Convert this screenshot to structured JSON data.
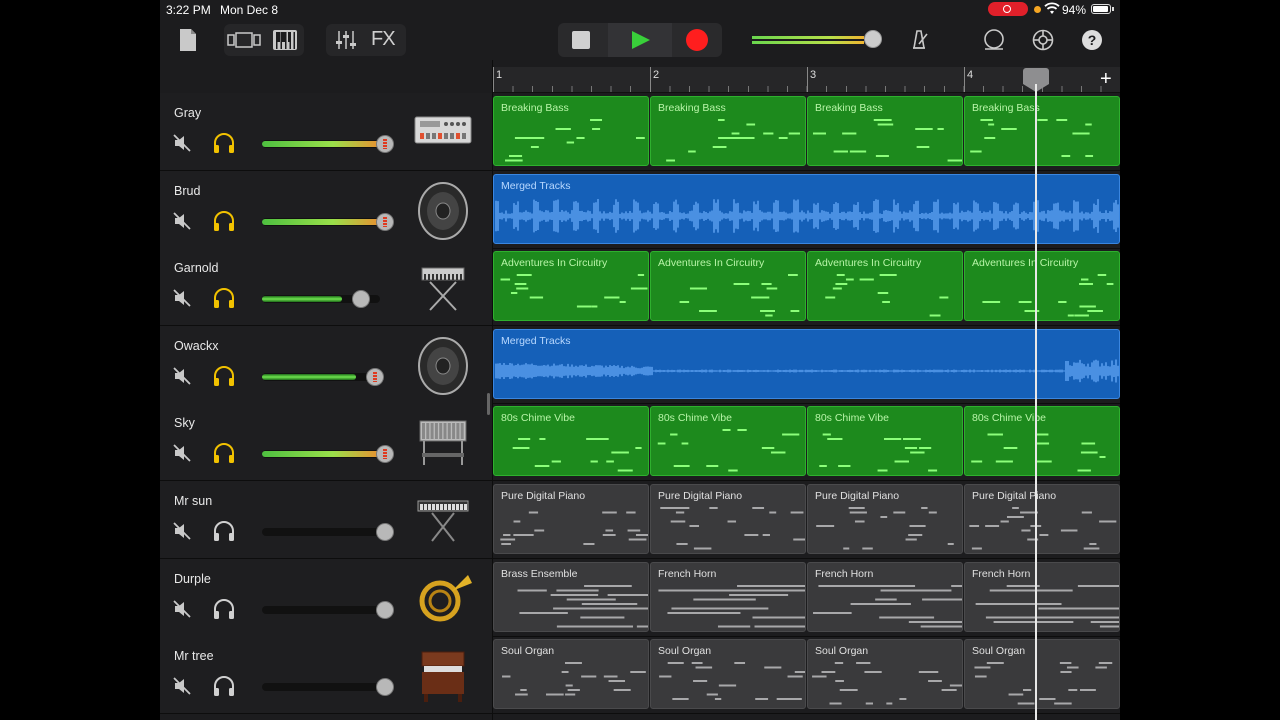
{
  "status_bar": {
    "time": "3:22 PM",
    "date": "Mon Dec 8",
    "battery": "94%",
    "battery_level": 0.94
  },
  "toolbar": {
    "fx_label": "FX",
    "help_label": "?",
    "master_volume": 0.95
  },
  "ruler": {
    "bars": [
      "1",
      "2",
      "3",
      "4"
    ],
    "add_label": "+"
  },
  "playhead_position_bars": 4.46,
  "colors": {
    "midi_region": "#1d8a1d",
    "audio_region": "#1560b8",
    "inactive_region": "#3a3a3c",
    "record": "#ff1e1e",
    "play": "#39d03a",
    "solo_active": "#f2c200"
  },
  "tracks": [
    {
      "name": "Gray",
      "instrument": "drum-machine-icon",
      "solo": true,
      "volume": 1.0,
      "hot": true,
      "kind": "green",
      "regions": [
        "Breaking Bass",
        "Breaking Bass",
        "Breaking Bass",
        "Breaking Bass"
      ]
    },
    {
      "name": "Brud",
      "instrument": "speaker-icon",
      "solo": true,
      "volume": 1.0,
      "hot": true,
      "kind": "blue",
      "regions": [
        "Merged Tracks"
      ]
    },
    {
      "name": "Garnold",
      "instrument": "keyboard-stand-icon",
      "solo": true,
      "volume": 0.68,
      "hot": false,
      "kind": "green",
      "regions": [
        "Adventures In Circuitry",
        "Adventures In Circuitry",
        "Adventures In Circuitry",
        "Adventures In Circuitry"
      ]
    },
    {
      "name": "Owackx",
      "instrument": "speaker-icon",
      "solo": true,
      "volume": 0.8,
      "hot": false,
      "kind": "blue",
      "regions": [
        "Merged Tracks"
      ]
    },
    {
      "name": "Sky",
      "instrument": "vibraphone-icon",
      "solo": true,
      "volume": 1.0,
      "hot": true,
      "kind": "green",
      "regions": [
        "80s Chime Vibe",
        "80s Chime Vibe",
        "80s Chime Vibe",
        "80s Chime Vibe"
      ]
    },
    {
      "name": "Mr sun",
      "instrument": "synth-keyboard-icon",
      "solo": false,
      "volume": 0.0,
      "hot": false,
      "kind": "gray",
      "regions": [
        "Pure Digital Piano",
        "Pure Digital Piano",
        "Pure Digital Piano",
        "Pure Digital Piano"
      ]
    },
    {
      "name": "Durple",
      "instrument": "french-horn-icon",
      "solo": false,
      "volume": 0.0,
      "hot": false,
      "kind": "gray",
      "regions": [
        "Brass Ensemble",
        "French Horn",
        "French Horn",
        "French Horn"
      ]
    },
    {
      "name": "Mr tree",
      "instrument": "organ-icon",
      "solo": false,
      "volume": 0.0,
      "hot": false,
      "kind": "gray",
      "regions": [
        "Soul Organ",
        "Soul Organ",
        "Soul Organ",
        "Soul Organ"
      ]
    }
  ]
}
